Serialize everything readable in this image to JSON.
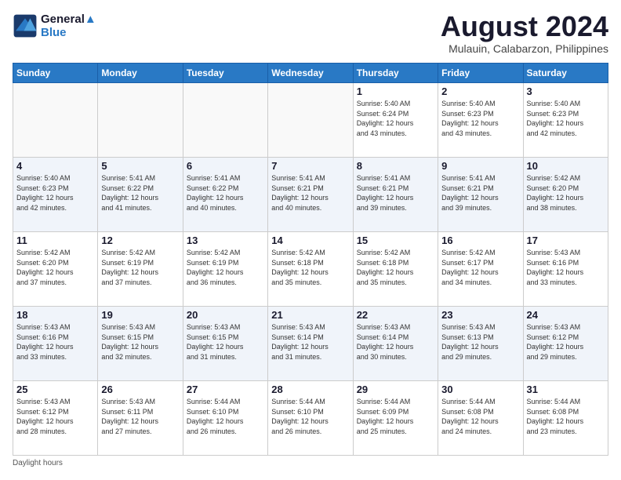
{
  "logo": {
    "line1": "General",
    "line2": "Blue"
  },
  "title": "August 2024",
  "subtitle": "Mulauin, Calabarzon, Philippines",
  "days_of_week": [
    "Sunday",
    "Monday",
    "Tuesday",
    "Wednesday",
    "Thursday",
    "Friday",
    "Saturday"
  ],
  "footer": "Daylight hours",
  "weeks": [
    [
      {
        "day": "",
        "info": ""
      },
      {
        "day": "",
        "info": ""
      },
      {
        "day": "",
        "info": ""
      },
      {
        "day": "",
        "info": ""
      },
      {
        "day": "1",
        "info": "Sunrise: 5:40 AM\nSunset: 6:24 PM\nDaylight: 12 hours\nand 43 minutes."
      },
      {
        "day": "2",
        "info": "Sunrise: 5:40 AM\nSunset: 6:23 PM\nDaylight: 12 hours\nand 43 minutes."
      },
      {
        "day": "3",
        "info": "Sunrise: 5:40 AM\nSunset: 6:23 PM\nDaylight: 12 hours\nand 42 minutes."
      }
    ],
    [
      {
        "day": "4",
        "info": "Sunrise: 5:40 AM\nSunset: 6:23 PM\nDaylight: 12 hours\nand 42 minutes."
      },
      {
        "day": "5",
        "info": "Sunrise: 5:41 AM\nSunset: 6:22 PM\nDaylight: 12 hours\nand 41 minutes."
      },
      {
        "day": "6",
        "info": "Sunrise: 5:41 AM\nSunset: 6:22 PM\nDaylight: 12 hours\nand 40 minutes."
      },
      {
        "day": "7",
        "info": "Sunrise: 5:41 AM\nSunset: 6:21 PM\nDaylight: 12 hours\nand 40 minutes."
      },
      {
        "day": "8",
        "info": "Sunrise: 5:41 AM\nSunset: 6:21 PM\nDaylight: 12 hours\nand 39 minutes."
      },
      {
        "day": "9",
        "info": "Sunrise: 5:41 AM\nSunset: 6:21 PM\nDaylight: 12 hours\nand 39 minutes."
      },
      {
        "day": "10",
        "info": "Sunrise: 5:42 AM\nSunset: 6:20 PM\nDaylight: 12 hours\nand 38 minutes."
      }
    ],
    [
      {
        "day": "11",
        "info": "Sunrise: 5:42 AM\nSunset: 6:20 PM\nDaylight: 12 hours\nand 37 minutes."
      },
      {
        "day": "12",
        "info": "Sunrise: 5:42 AM\nSunset: 6:19 PM\nDaylight: 12 hours\nand 37 minutes."
      },
      {
        "day": "13",
        "info": "Sunrise: 5:42 AM\nSunset: 6:19 PM\nDaylight: 12 hours\nand 36 minutes."
      },
      {
        "day": "14",
        "info": "Sunrise: 5:42 AM\nSunset: 6:18 PM\nDaylight: 12 hours\nand 35 minutes."
      },
      {
        "day": "15",
        "info": "Sunrise: 5:42 AM\nSunset: 6:18 PM\nDaylight: 12 hours\nand 35 minutes."
      },
      {
        "day": "16",
        "info": "Sunrise: 5:42 AM\nSunset: 6:17 PM\nDaylight: 12 hours\nand 34 minutes."
      },
      {
        "day": "17",
        "info": "Sunrise: 5:43 AM\nSunset: 6:16 PM\nDaylight: 12 hours\nand 33 minutes."
      }
    ],
    [
      {
        "day": "18",
        "info": "Sunrise: 5:43 AM\nSunset: 6:16 PM\nDaylight: 12 hours\nand 33 minutes."
      },
      {
        "day": "19",
        "info": "Sunrise: 5:43 AM\nSunset: 6:15 PM\nDaylight: 12 hours\nand 32 minutes."
      },
      {
        "day": "20",
        "info": "Sunrise: 5:43 AM\nSunset: 6:15 PM\nDaylight: 12 hours\nand 31 minutes."
      },
      {
        "day": "21",
        "info": "Sunrise: 5:43 AM\nSunset: 6:14 PM\nDaylight: 12 hours\nand 31 minutes."
      },
      {
        "day": "22",
        "info": "Sunrise: 5:43 AM\nSunset: 6:14 PM\nDaylight: 12 hours\nand 30 minutes."
      },
      {
        "day": "23",
        "info": "Sunrise: 5:43 AM\nSunset: 6:13 PM\nDaylight: 12 hours\nand 29 minutes."
      },
      {
        "day": "24",
        "info": "Sunrise: 5:43 AM\nSunset: 6:12 PM\nDaylight: 12 hours\nand 29 minutes."
      }
    ],
    [
      {
        "day": "25",
        "info": "Sunrise: 5:43 AM\nSunset: 6:12 PM\nDaylight: 12 hours\nand 28 minutes."
      },
      {
        "day": "26",
        "info": "Sunrise: 5:43 AM\nSunset: 6:11 PM\nDaylight: 12 hours\nand 27 minutes."
      },
      {
        "day": "27",
        "info": "Sunrise: 5:44 AM\nSunset: 6:10 PM\nDaylight: 12 hours\nand 26 minutes."
      },
      {
        "day": "28",
        "info": "Sunrise: 5:44 AM\nSunset: 6:10 PM\nDaylight: 12 hours\nand 26 minutes."
      },
      {
        "day": "29",
        "info": "Sunrise: 5:44 AM\nSunset: 6:09 PM\nDaylight: 12 hours\nand 25 minutes."
      },
      {
        "day": "30",
        "info": "Sunrise: 5:44 AM\nSunset: 6:08 PM\nDaylight: 12 hours\nand 24 minutes."
      },
      {
        "day": "31",
        "info": "Sunrise: 5:44 AM\nSunset: 6:08 PM\nDaylight: 12 hours\nand 23 minutes."
      }
    ]
  ]
}
